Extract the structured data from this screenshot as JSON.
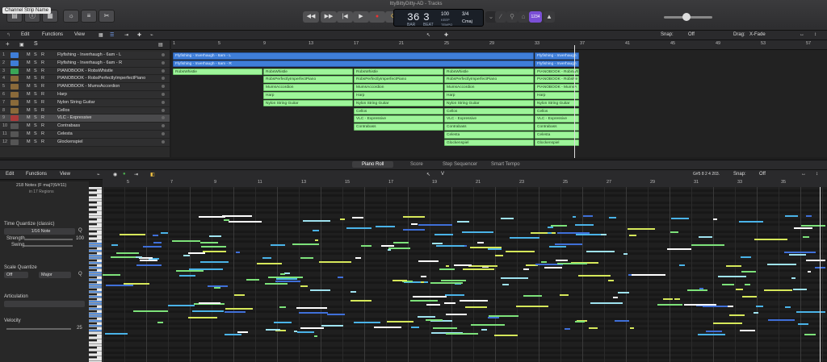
{
  "window": {
    "title": "IttyBittyDitty-AD - Tracks",
    "tooltip": "Channel Strip Name"
  },
  "lcd": {
    "bar": "36",
    "beat": "3",
    "bar_label": "BAR",
    "beat_label": "BEAT",
    "tempo": "100",
    "tempo_label": "KEEP",
    "tempo_sub": "TEMPO",
    "sig": "3/4",
    "key": "Cmaj",
    "count": "1234"
  },
  "tracks_menu": {
    "edit": "Edit",
    "functions": "Functions",
    "view": "View",
    "snap_label": "Snap:",
    "snap": "Off",
    "drag_label": "Drag:",
    "drag": "X-Fade"
  },
  "ruler": [
    "1",
    "5",
    "9",
    "13",
    "17",
    "21",
    "25",
    "29",
    "33",
    "37",
    "41",
    "45",
    "49",
    "53",
    "57"
  ],
  "tracks": [
    {
      "num": "1",
      "name": "Flyfishing - Inverhaugh - 6am - L",
      "color": "#3f7ed8"
    },
    {
      "num": "2",
      "name": "Flyfishing - Inverhaugh - 6am - R",
      "color": "#3f7ed8"
    },
    {
      "num": "3",
      "name": "PIANOBOOK - RobsWhistle",
      "color": "#3aa657"
    },
    {
      "num": "4",
      "name": "PIANOBOOK - RobsPerfectlyImperfectPiano",
      "color": "#8a6a3a"
    },
    {
      "num": "5",
      "name": "PIANOBOOK - MumsAccordion",
      "color": "#8a6a3a"
    },
    {
      "num": "6",
      "name": "Harp",
      "color": "#8a6a3a"
    },
    {
      "num": "7",
      "name": "Nylon String Guitar",
      "color": "#8a6a3a"
    },
    {
      "num": "8",
      "name": "Cellos",
      "color": "#8a6a3a"
    },
    {
      "num": "9",
      "name": "VLC - Expressive",
      "color": "#aa3a3a"
    },
    {
      "num": "10",
      "name": "Contrabass",
      "color": "#555"
    },
    {
      "num": "11",
      "name": "Celesta",
      "color": "#555"
    },
    {
      "num": "12",
      "name": "Glockenspiel",
      "color": "#555"
    }
  ],
  "regions": {
    "blue1": "Flyfishing - Inverhaugh - 6am - L",
    "blue1b": "Flyfishing - Inverhaugh",
    "blue2": "Flyfishing - Inverhaugh - 6am - R",
    "blue2b": "Flyfishing - Inverhaugh",
    "whistle": "RobsWhistle",
    "piano": "RobsPerfectlyImperfectPiano",
    "accordion": "MumsAccordion",
    "harp": "Harp",
    "guitar": "Nylon String Guitar",
    "cellos": "Cellos",
    "vlc": "VLC - Expressive",
    "contrabass": "Contrabass",
    "celesta": "Celesta",
    "glock": "Glockenspiel",
    "pb_whistle": "PIANOBOOK - RobsWhi",
    "pb_piano": "PIANOBOOK - RobsPe",
    "pb_accordion": "PIANOBOOK - MumsA"
  },
  "tabs": {
    "piano_roll": "Piano Roll",
    "score": "Score",
    "step": "Step Sequencer",
    "smart": "Smart Tempo"
  },
  "piano_roll": {
    "edit": "Edit",
    "functions": "Functions",
    "view": "View",
    "snap_label": "Snap:",
    "snap": "Off",
    "position": "G#5  8 2 4 203.",
    "notes_info": "218 Notes (F maj7(6/#11)",
    "regions_info": "in 17 Regions",
    "ruler": [
      "5",
      "7",
      "9",
      "11",
      "13",
      "15",
      "17",
      "19",
      "21",
      "23",
      "25",
      "27",
      "29",
      "31",
      "33",
      "35"
    ],
    "time_quantize": "Time Quantize (classic)",
    "quantize_value": "1/16 Note",
    "strength_label": "Strength",
    "strength": "100",
    "swing_label": "Swing",
    "scale_quantize": "Scale Quantize",
    "scale_off": "Off",
    "scale_major": "Major",
    "articulation": "Articulation",
    "velocity_label": "Velocity",
    "velocity": "25"
  }
}
